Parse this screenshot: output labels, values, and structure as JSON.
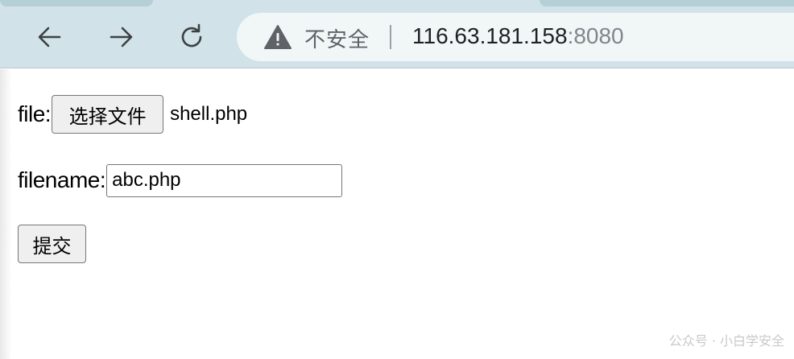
{
  "browser": {
    "security_label": "不安全",
    "url_host": "116.63.181.158",
    "url_port": ":8080",
    "icons": {
      "back": "arrow-left-icon",
      "forward": "arrow-right-icon",
      "reload": "reload-icon",
      "security": "warning-triangle-icon"
    }
  },
  "form": {
    "file_label": "file:",
    "choose_file_button": "选择文件",
    "chosen_file_name": "shell.php",
    "filename_label": "filename:",
    "filename_value": "abc.php",
    "submit_button": "提交"
  },
  "watermark": "公众号 · 小白学安全"
}
